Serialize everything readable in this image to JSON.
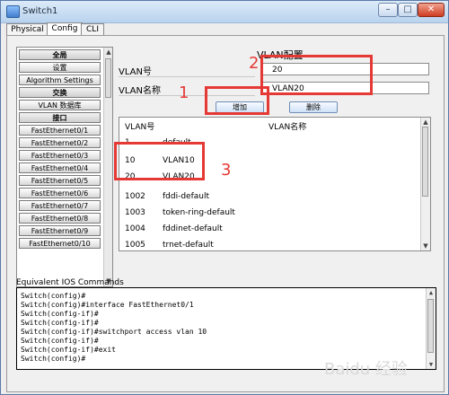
{
  "window": {
    "title": "Switch1"
  },
  "tabs": [
    {
      "label": "Physical"
    },
    {
      "label": "Config"
    },
    {
      "label": "CLI"
    }
  ],
  "left_nav": {
    "items": [
      {
        "label": "全局",
        "kind": "section"
      },
      {
        "label": "设置"
      },
      {
        "label": "Algorithm Settings"
      },
      {
        "label": "交换",
        "kind": "section"
      },
      {
        "label": "VLAN 数据库"
      },
      {
        "label": "接口",
        "kind": "section"
      },
      {
        "label": "FastEthernet0/1"
      },
      {
        "label": "FastEthernet0/2"
      },
      {
        "label": "FastEthernet0/3"
      },
      {
        "label": "FastEthernet0/4"
      },
      {
        "label": "FastEthernet0/5"
      },
      {
        "label": "FastEthernet0/6"
      },
      {
        "label": "FastEthernet0/7"
      },
      {
        "label": "FastEthernet0/8"
      },
      {
        "label": "FastEthernet0/9"
      },
      {
        "label": "FastEthernet0/10"
      }
    ]
  },
  "vlan_config": {
    "title": "VLAN配置",
    "vlan_number_label": "VLAN号",
    "vlan_number_value": "20",
    "vlan_name_label": "VLAN名称",
    "vlan_name_value": "VLAN20",
    "add_button": "增加",
    "delete_button": "删除",
    "table": {
      "headers": [
        "VLAN号",
        "VLAN名称"
      ],
      "rows": [
        {
          "id": "1",
          "name": "default"
        },
        {
          "id": "10",
          "name": "VLAN10"
        },
        {
          "id": "20",
          "name": "VLAN20"
        },
        {
          "id": "1002",
          "name": "fddi-default"
        },
        {
          "id": "1003",
          "name": "token-ring-default"
        },
        {
          "id": "1004",
          "name": "fddinet-default"
        },
        {
          "id": "1005",
          "name": "trnet-default"
        }
      ]
    }
  },
  "ios": {
    "label": "Equivalent IOS Commands",
    "lines": [
      "Switch(config)#",
      "Switch(config)#interface FastEthernet0/1",
      "Switch(config-if)#",
      "Switch(config-if)#",
      "Switch(config-if)#switchport access vlan 10",
      "Switch(config-if)#",
      "Switch(config-if)#exit",
      "Switch(config)#"
    ]
  },
  "annotations": {
    "one": "1",
    "two": "2",
    "three": "3"
  },
  "watermark": "Baidu 经验",
  "colors": {
    "annotation": "#e53935"
  }
}
